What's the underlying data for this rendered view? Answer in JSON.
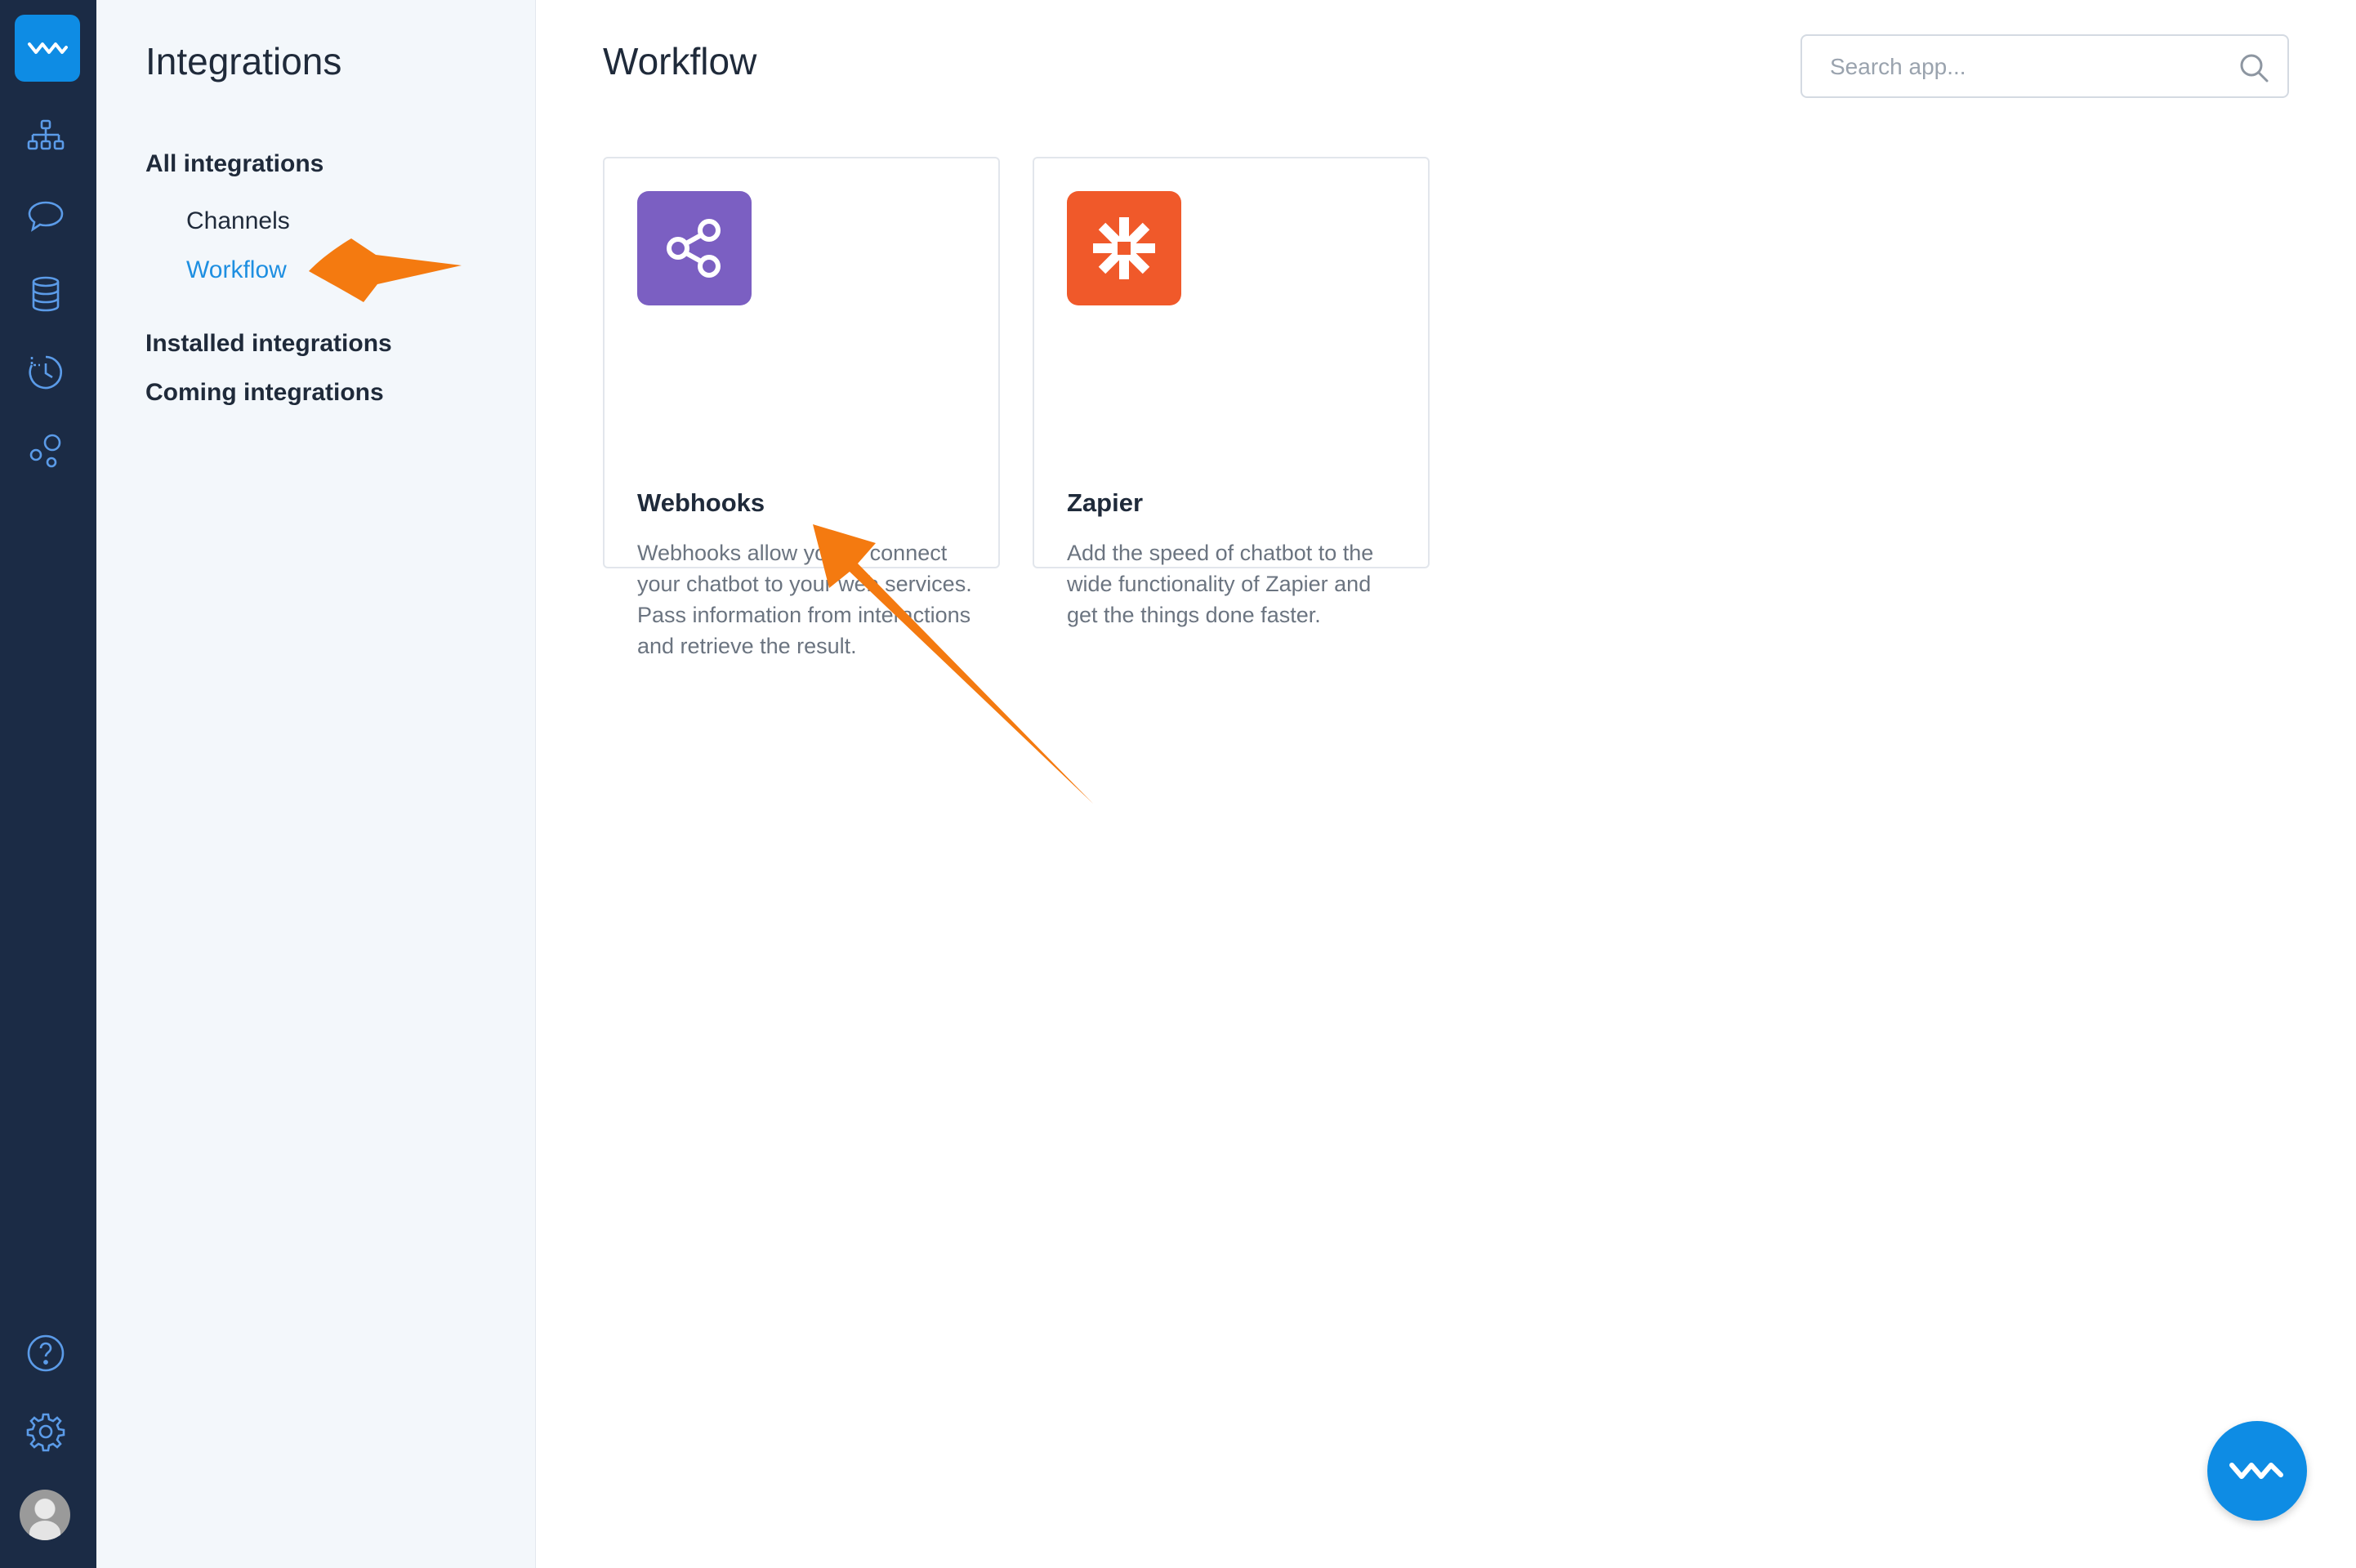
{
  "sidebar": {
    "title": "Integrations",
    "items": [
      {
        "label": "All integrations"
      },
      {
        "label": "Channels"
      },
      {
        "label": "Workflow"
      },
      {
        "label": "Installed integrations"
      },
      {
        "label": "Coming integrations"
      }
    ]
  },
  "main": {
    "title": "Workflow",
    "search": {
      "placeholder": "Search app..."
    },
    "cards": [
      {
        "name": "Webhooks",
        "description": "Webhooks allow you to connect your chatbot to your web services. Pass information from interactions and retrieve the result.",
        "icon": "share-nodes-icon",
        "color": "#7b5fc2"
      },
      {
        "name": "Zapier",
        "description": "Add the speed of chatbot to the wide functionality of Zapier and get the things done faster.",
        "icon": "asterisk-icon",
        "color": "#f0592a"
      }
    ]
  },
  "rail": {
    "icons": [
      "logo-wave-icon",
      "hierarchy-icon",
      "chat-bubble-icon",
      "database-icon",
      "history-clock-icon",
      "integrations-bubbles-icon",
      "help-icon",
      "settings-gear-icon",
      "user-avatar"
    ]
  },
  "colors": {
    "rail_bg": "#1b2b45",
    "accent": "#1e8fe1",
    "annotation_arrow": "#f47a10"
  }
}
